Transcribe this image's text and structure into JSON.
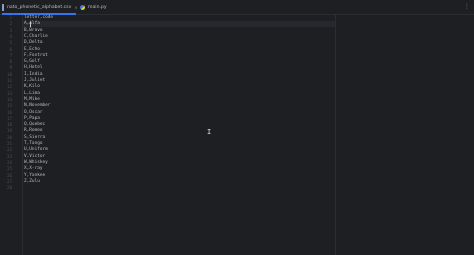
{
  "tabs": [
    {
      "label": "nato_phonetic_alphabet.csv",
      "icon": "csv-file-icon",
      "active": true
    },
    {
      "label": "main.py",
      "icon": "python-file-icon",
      "active": false
    }
  ],
  "tab_close_glyph": "×",
  "more_glyph": "⋮",
  "editor": {
    "line_numbers": [
      "1",
      "2",
      "3",
      "4",
      "5",
      "6",
      "7",
      "8",
      "9",
      "10",
      "11",
      "12",
      "13",
      "14",
      "15",
      "16",
      "17",
      "18",
      "19",
      "20",
      "21",
      "22",
      "23",
      "24",
      "25",
      "26",
      "27",
      "28"
    ],
    "lines": [
      "letter,code",
      "A,Alfa",
      "B,Bravo",
      "C,Charlie",
      "D,Delta",
      "E,Echo",
      "F,Foxtrot",
      "G,Golf",
      "H,Hotel",
      "I,India",
      "J,Juliet",
      "K,Kilo",
      "L,Lima",
      "M,Mike",
      "N,November",
      "O,Oscar",
      "P,Papa",
      "Q,Quebec",
      "R,Romeo",
      "S,Sierra",
      "T,Tango",
      "U,Uniform",
      "V,Victor",
      "W,Whiskey",
      "X,X-ray",
      "Y,Yankee",
      "Z,Zulu",
      ""
    ]
  },
  "cursor_glyph": "I"
}
